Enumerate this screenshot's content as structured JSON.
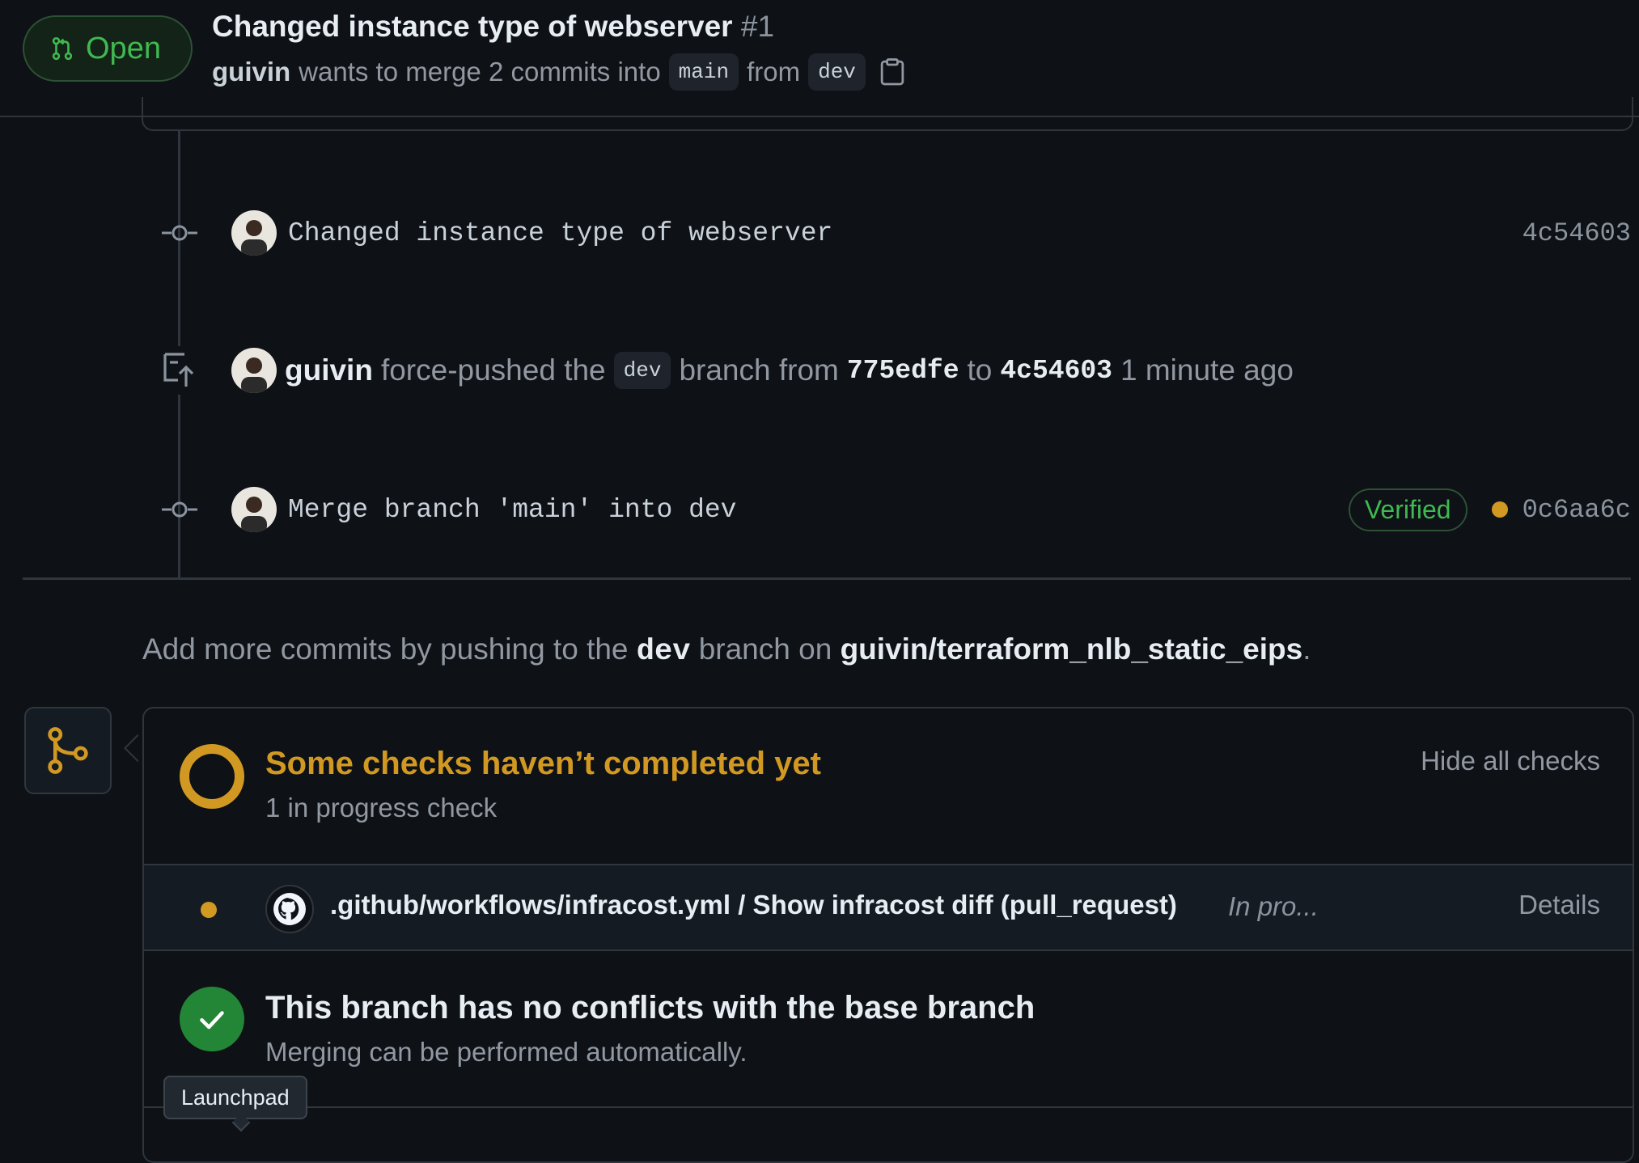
{
  "header": {
    "status_label": "Open",
    "title": "Changed instance type of webserver",
    "number": "#1",
    "author": "guivin",
    "merge_text": "wants to merge 2 commits into",
    "base_branch": "main",
    "from_text": "from",
    "head_branch": "dev"
  },
  "timeline": {
    "commit1": {
      "message": "Changed instance type of webserver",
      "sha": "4c54603"
    },
    "force_push": {
      "author": "guivin",
      "text1": "force-pushed the",
      "branch": "dev",
      "text2": "branch from",
      "from_sha": "775edfe",
      "text3": "to",
      "to_sha": "4c54603",
      "time": "1 minute ago"
    },
    "commit2": {
      "message": "Merge branch 'main' into dev",
      "verified": "Verified",
      "sha": "0c6aa6c"
    }
  },
  "add_more": {
    "prefix": "Add more commits by pushing to the",
    "branch": "dev",
    "middle": "branch on",
    "repo": "guivin/terraform_nlb_static_eips",
    "suffix": "."
  },
  "checks": {
    "title": "Some checks haven’t completed yet",
    "subtitle": "1 in progress check",
    "hide_label": "Hide all checks",
    "items": [
      {
        "name": ".github/workflows/infracost.yml / Show infracost diff (pull_request)",
        "status": "In pro...",
        "details": "Details"
      }
    ]
  },
  "conflicts": {
    "title": "This branch has no conflicts with the base branch",
    "subtitle": "Merging can be performed automatically."
  },
  "tooltip": "Launchpad",
  "colors": {
    "open_green": "#3fb950",
    "pending_yellow": "#d29922",
    "success_green": "#238636",
    "background": "#0e1116"
  },
  "icons": [
    "pull-request-icon",
    "copy-icon",
    "commit-icon",
    "force-push-icon",
    "git-merge-icon",
    "github-logo-icon",
    "check-icon"
  ]
}
